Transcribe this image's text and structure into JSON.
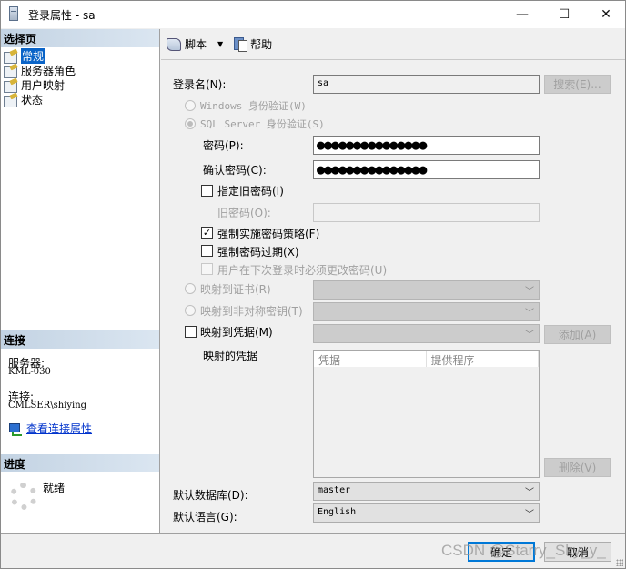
{
  "window": {
    "title": "登录属性 - sa",
    "controls": {
      "minimize": "—",
      "maximize": "☐",
      "close": "✕"
    }
  },
  "left_panel": {
    "select_page_header": "选择页",
    "pages": [
      {
        "label": "常规",
        "selected": true
      },
      {
        "label": "服务器角色",
        "selected": false
      },
      {
        "label": "用户映射",
        "selected": false
      },
      {
        "label": "状态",
        "selected": false
      }
    ],
    "connection_header": "连接",
    "server_label": "服务器:",
    "server_value": "KML-030",
    "connection_label": "连接:",
    "connection_value": "CMLSER\\shiying",
    "view_connection_link": "查看连接属性",
    "progress_header": "进度",
    "progress_status": "就绪"
  },
  "toolbar": {
    "script_label": "脚本",
    "help_label": "帮助"
  },
  "form": {
    "login_name_label": "登录名(N):",
    "login_name_value": "sa",
    "search_button": "搜索(E)...",
    "windows_auth_label": "Windows 身份验证(W)",
    "sql_auth_label": "SQL Server 身份验证(S)",
    "auth_mode": "sql",
    "password_label": "密码(P):",
    "password_value": "●●●●●●●●●●●●●●●",
    "confirm_password_label": "确认密码(C):",
    "confirm_password_value": "●●●●●●●●●●●●●●●",
    "specify_old_password_label": "指定旧密码(I)",
    "specify_old_password_checked": false,
    "old_password_label": "旧密码(O):",
    "old_password_value": "",
    "enforce_policy_label": "强制实施密码策略(F)",
    "enforce_policy_checked": true,
    "enforce_expiration_label": "强制密码过期(X)",
    "enforce_expiration_checked": false,
    "must_change_label": "用户在下次登录时必须更改密码(U)",
    "must_change_checked": false,
    "map_cert_label": "映射到证书(R)",
    "map_asym_key_label": "映射到非对称密钥(T)",
    "map_credential_label": "映射到凭据(M)",
    "map_credential_checked": false,
    "add_button": "添加(A)",
    "mapped_credentials_label": "映射的凭据",
    "credentials_columns": [
      "凭据",
      "提供程序"
    ],
    "credentials_rows": [],
    "remove_button": "删除(V)",
    "default_database_label": "默认数据库(D):",
    "default_database_value": "master",
    "default_language_label": "默认语言(G):",
    "default_language_value": "English"
  },
  "footer": {
    "ok_button": "确定",
    "cancel_button": "取消",
    "watermark": "CSDN @Starry_Sky_y_"
  }
}
